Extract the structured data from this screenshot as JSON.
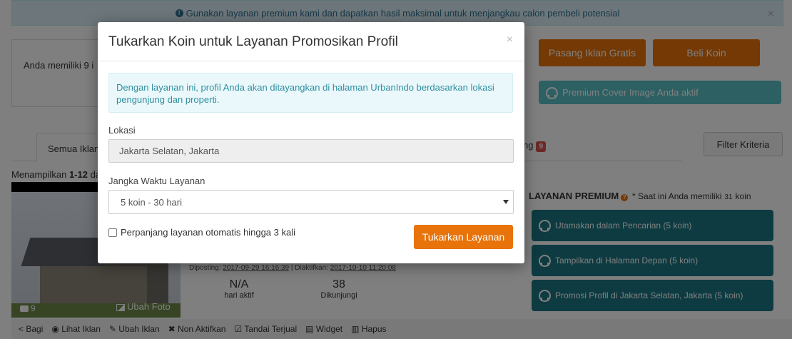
{
  "alert": {
    "text": "Gunakan layanan premium kami dan dapatkan hasil maksimal untuk menjangkau calon pembeli potensial",
    "close": "×"
  },
  "summary": {
    "text": "Anda memiliki 9 i"
  },
  "buttons": {
    "free_ad": "Pasang Iklan Gratis",
    "buy_coin": "Beli Koin",
    "premium_cover": "Premium Cover Image Anda aktif",
    "filter": "Filter Kriteria"
  },
  "tabs": {
    "all": "Semua Iklan",
    "ing_suffix": "ng",
    "ing_badge": "9"
  },
  "showing": {
    "prefix": "Menampilkan",
    "range": "1-12",
    "suffix": "da"
  },
  "listing": {
    "photo_count": "9",
    "change_photo": "Ubah Foto",
    "posted_label": "Diposting:",
    "posted_date": "2017-09-29 16:16:39",
    "active_label": "Diaktifkan:",
    "active_date": "2017-10-10 11:20:08",
    "days_active_value": "N/A",
    "days_active_label": "hari aktif",
    "visits_value": "38",
    "visits_label": "Dikunjungi"
  },
  "actions": [
    "Bagi",
    "Lihat Iklan",
    "Ubah Iklan",
    "Non Aktifkan",
    "Tandai Terjual",
    "Widget",
    "Hapus"
  ],
  "premium": {
    "title": "LAYANAN PREMIUM",
    "note_prefix": "* Saat ini Anda memiliki",
    "coins": "31",
    "note_suffix": "koin",
    "options": [
      "Utamakan dalam Pencarian (5 koin)",
      "Tampilkan di Halaman Depan (5 koin)",
      "Promosi Profil di Jakarta Selatan, Jakarta (5 koin)"
    ]
  },
  "modal": {
    "title": "Tukarkan Koin untuk Layanan Promosikan Profil",
    "close": "×",
    "info": "Dengan layanan ini, profil Anda akan ditayangkan di halaman UrbanIndo berdasarkan lokasi pengunjung dan properti.",
    "location_label": "Lokasi",
    "location_value": "Jakarta Selatan, Jakarta",
    "duration_label": "Jangka Waktu Layanan",
    "duration_value": "5 koin - 30 hari",
    "auto_renew_label": "Perpanjang layanan otomatis hingga 3 kali",
    "submit": "Tukarkan Layanan"
  },
  "colors": {
    "accent": "#e8730a",
    "teal": "#1a7683",
    "info_bg": "#eaf8fb"
  }
}
